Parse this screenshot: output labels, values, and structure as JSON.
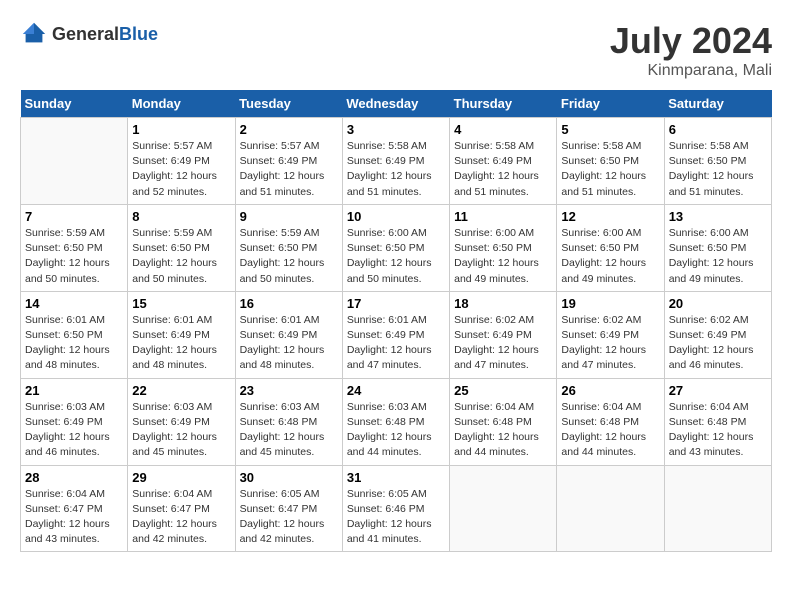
{
  "header": {
    "logo_general": "General",
    "logo_blue": "Blue",
    "month": "July 2024",
    "location": "Kinmparana, Mali"
  },
  "weekdays": [
    "Sunday",
    "Monday",
    "Tuesday",
    "Wednesday",
    "Thursday",
    "Friday",
    "Saturday"
  ],
  "weeks": [
    [
      {
        "day": "",
        "info": ""
      },
      {
        "day": "1",
        "info": "Sunrise: 5:57 AM\nSunset: 6:49 PM\nDaylight: 12 hours\nand 52 minutes."
      },
      {
        "day": "2",
        "info": "Sunrise: 5:57 AM\nSunset: 6:49 PM\nDaylight: 12 hours\nand 51 minutes."
      },
      {
        "day": "3",
        "info": "Sunrise: 5:58 AM\nSunset: 6:49 PM\nDaylight: 12 hours\nand 51 minutes."
      },
      {
        "day": "4",
        "info": "Sunrise: 5:58 AM\nSunset: 6:49 PM\nDaylight: 12 hours\nand 51 minutes."
      },
      {
        "day": "5",
        "info": "Sunrise: 5:58 AM\nSunset: 6:50 PM\nDaylight: 12 hours\nand 51 minutes."
      },
      {
        "day": "6",
        "info": "Sunrise: 5:58 AM\nSunset: 6:50 PM\nDaylight: 12 hours\nand 51 minutes."
      }
    ],
    [
      {
        "day": "7",
        "info": "Sunrise: 5:59 AM\nSunset: 6:50 PM\nDaylight: 12 hours\nand 50 minutes."
      },
      {
        "day": "8",
        "info": "Sunrise: 5:59 AM\nSunset: 6:50 PM\nDaylight: 12 hours\nand 50 minutes."
      },
      {
        "day": "9",
        "info": "Sunrise: 5:59 AM\nSunset: 6:50 PM\nDaylight: 12 hours\nand 50 minutes."
      },
      {
        "day": "10",
        "info": "Sunrise: 6:00 AM\nSunset: 6:50 PM\nDaylight: 12 hours\nand 50 minutes."
      },
      {
        "day": "11",
        "info": "Sunrise: 6:00 AM\nSunset: 6:50 PM\nDaylight: 12 hours\nand 49 minutes."
      },
      {
        "day": "12",
        "info": "Sunrise: 6:00 AM\nSunset: 6:50 PM\nDaylight: 12 hours\nand 49 minutes."
      },
      {
        "day": "13",
        "info": "Sunrise: 6:00 AM\nSunset: 6:50 PM\nDaylight: 12 hours\nand 49 minutes."
      }
    ],
    [
      {
        "day": "14",
        "info": "Sunrise: 6:01 AM\nSunset: 6:50 PM\nDaylight: 12 hours\nand 48 minutes."
      },
      {
        "day": "15",
        "info": "Sunrise: 6:01 AM\nSunset: 6:49 PM\nDaylight: 12 hours\nand 48 minutes."
      },
      {
        "day": "16",
        "info": "Sunrise: 6:01 AM\nSunset: 6:49 PM\nDaylight: 12 hours\nand 48 minutes."
      },
      {
        "day": "17",
        "info": "Sunrise: 6:01 AM\nSunset: 6:49 PM\nDaylight: 12 hours\nand 47 minutes."
      },
      {
        "day": "18",
        "info": "Sunrise: 6:02 AM\nSunset: 6:49 PM\nDaylight: 12 hours\nand 47 minutes."
      },
      {
        "day": "19",
        "info": "Sunrise: 6:02 AM\nSunset: 6:49 PM\nDaylight: 12 hours\nand 47 minutes."
      },
      {
        "day": "20",
        "info": "Sunrise: 6:02 AM\nSunset: 6:49 PM\nDaylight: 12 hours\nand 46 minutes."
      }
    ],
    [
      {
        "day": "21",
        "info": "Sunrise: 6:03 AM\nSunset: 6:49 PM\nDaylight: 12 hours\nand 46 minutes."
      },
      {
        "day": "22",
        "info": "Sunrise: 6:03 AM\nSunset: 6:49 PM\nDaylight: 12 hours\nand 45 minutes."
      },
      {
        "day": "23",
        "info": "Sunrise: 6:03 AM\nSunset: 6:48 PM\nDaylight: 12 hours\nand 45 minutes."
      },
      {
        "day": "24",
        "info": "Sunrise: 6:03 AM\nSunset: 6:48 PM\nDaylight: 12 hours\nand 44 minutes."
      },
      {
        "day": "25",
        "info": "Sunrise: 6:04 AM\nSunset: 6:48 PM\nDaylight: 12 hours\nand 44 minutes."
      },
      {
        "day": "26",
        "info": "Sunrise: 6:04 AM\nSunset: 6:48 PM\nDaylight: 12 hours\nand 44 minutes."
      },
      {
        "day": "27",
        "info": "Sunrise: 6:04 AM\nSunset: 6:48 PM\nDaylight: 12 hours\nand 43 minutes."
      }
    ],
    [
      {
        "day": "28",
        "info": "Sunrise: 6:04 AM\nSunset: 6:47 PM\nDaylight: 12 hours\nand 43 minutes."
      },
      {
        "day": "29",
        "info": "Sunrise: 6:04 AM\nSunset: 6:47 PM\nDaylight: 12 hours\nand 42 minutes."
      },
      {
        "day": "30",
        "info": "Sunrise: 6:05 AM\nSunset: 6:47 PM\nDaylight: 12 hours\nand 42 minutes."
      },
      {
        "day": "31",
        "info": "Sunrise: 6:05 AM\nSunset: 6:46 PM\nDaylight: 12 hours\nand 41 minutes."
      },
      {
        "day": "",
        "info": ""
      },
      {
        "day": "",
        "info": ""
      },
      {
        "day": "",
        "info": ""
      }
    ]
  ]
}
